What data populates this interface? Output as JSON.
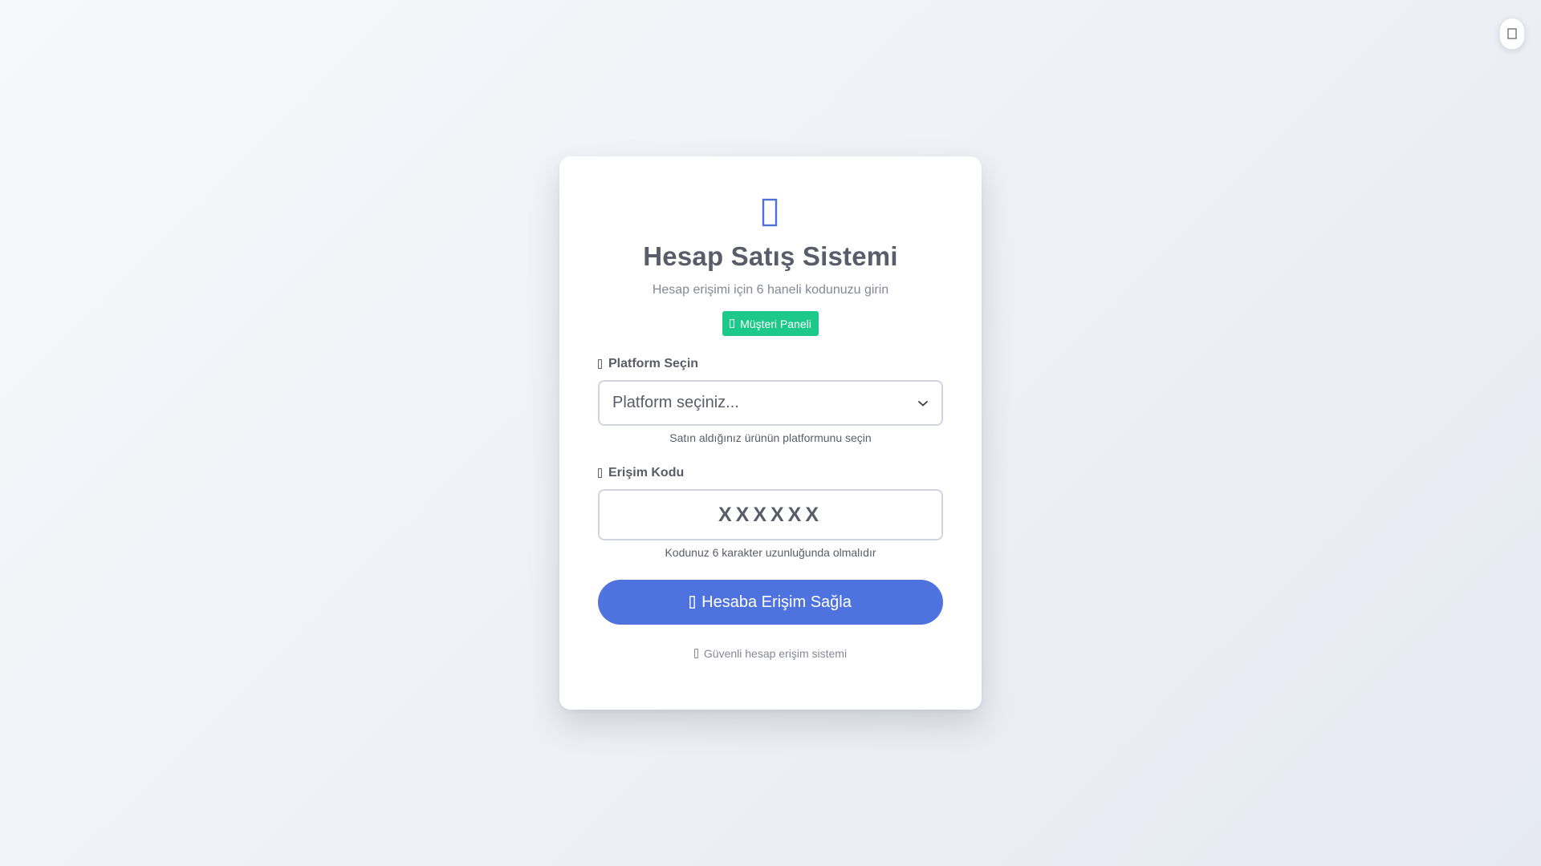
{
  "header": {
    "title": "Hesap Satış Sistemi",
    "subtitle": "Hesap erişimi için 6 haneli kodunuzu girin",
    "panel_button_label": "Müşteri Paneli"
  },
  "platform": {
    "label": "Platform Seçin",
    "selected_value": "Platform seçiniz...",
    "help": "Satın aldığınız ürünün platformunu seçin"
  },
  "code": {
    "label": "Erişim Kodu",
    "placeholder": "XXXXXX",
    "value": "",
    "help": "Kodunuz 6 karakter uzunluğunda olmalıdır"
  },
  "submit": {
    "label": "Hesaba Erişim Sağla"
  },
  "footer": {
    "note": "Güvenli hesap erişim sistemi"
  },
  "icons": {
    "theme_toggle": "moon-icon",
    "logo": "shield-icon",
    "panel": "user-icon",
    "platform": "layers-icon",
    "code": "key-icon",
    "chevron": "chevron-down-icon",
    "submit": "login-icon",
    "footer": "lock-icon"
  },
  "colors": {
    "primary": "#4e73df",
    "success": "#1cc88a",
    "text": "#5a5c69",
    "muted": "#858796",
    "border": "#d1d3e2"
  }
}
